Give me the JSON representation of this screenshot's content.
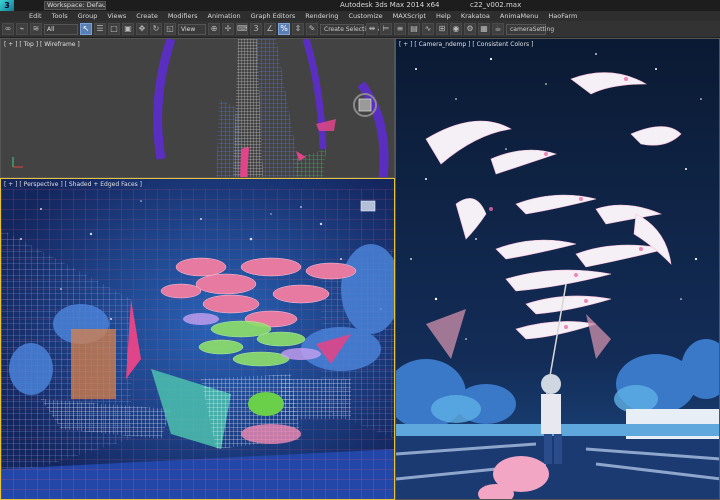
{
  "titlebar": {
    "logo": "3",
    "workspace": "Workspace: Default",
    "app_title": "Autodesk 3ds Max  2014 x64",
    "file_name": "c22_v002.max"
  },
  "menubar": {
    "items": [
      "Edit",
      "Tools",
      "Group",
      "Views",
      "Create",
      "Modifiers",
      "Animation",
      "Graph Editors",
      "Rendering",
      "Customize",
      "MAXScript",
      "Help",
      "Krakatoa",
      "AnimaMenu",
      "HaoFarm"
    ]
  },
  "toolbar": {
    "selection_filter": "All",
    "ref_coord": "View",
    "named_selection": "Create Selection S",
    "camera_setting": "cameraSetting"
  },
  "viewports": {
    "top_label": "[ + ] [ Top ] [ Wireframe ]",
    "perspective_label": "[ + ] [ Perspective ] [ Shaded + Edged Faces ]",
    "camera_label": "[ + ] [ Camera_ndemp ] [ Consistent Colors ]"
  },
  "colors": {
    "accent_selected_viewport": "#e6c23a",
    "wire_magenta": "#e0458a",
    "wire_blue": "#4a6fe0",
    "fish_pink": "#f06aa8",
    "fish_white": "#f4f0f6",
    "night_sky": "#0e1c3a"
  }
}
